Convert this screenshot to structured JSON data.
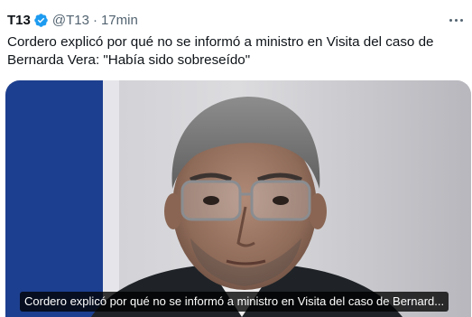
{
  "tweet": {
    "author_name": "T13",
    "handle": "@T13",
    "separator": "·",
    "time": "17min",
    "text": "Cordero explicó por qué no se informó a ministro en Visita del caso de Bernarda Vera: \"Había sido sobreseído\"",
    "verified_icon": "verified-badge-icon",
    "more_icon": "more-options-icon"
  },
  "media": {
    "caption": "Cordero explicó por qué no se informó a ministro en Visita del caso de Bernard...",
    "flag_blue": "#1d3f8f",
    "verified_color": "#1d9bf0"
  }
}
